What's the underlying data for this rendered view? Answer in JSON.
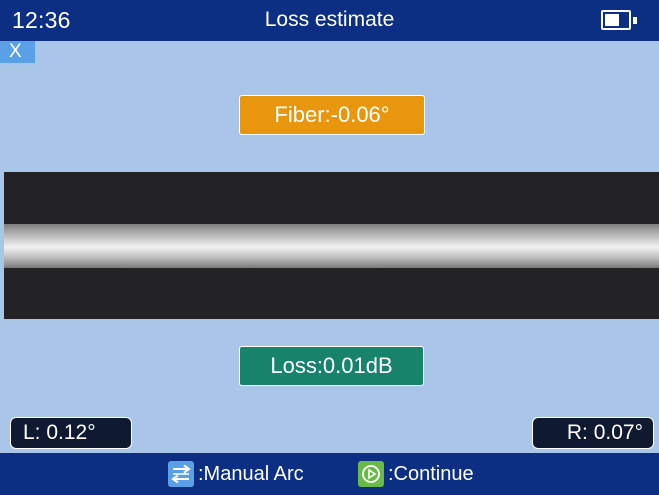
{
  "status_bar": {
    "time": "12:36",
    "title": "Loss estimate",
    "battery_icon": "battery-icon",
    "battery_level": 0.55
  },
  "close_button": {
    "label": "X"
  },
  "fiber_angle": {
    "label": "Fiber:-0.06°"
  },
  "fiber_view": {
    "description_icon": "fiber-image"
  },
  "loss": {
    "label": "Loss:0.01dB"
  },
  "cleave_angles": {
    "left": "L: 0.12°",
    "right": "R: 0.07°"
  },
  "bottom_hints": {
    "manual_arc": {
      "icon": "manual-arc-key-icon",
      "label": ":Manual Arc"
    },
    "continue": {
      "icon": "play-circle-icon",
      "label": ":Continue"
    }
  },
  "colors": {
    "bar_blue": "#0d2f83",
    "background": "#a9c5e7",
    "fiber_badge": "#e8960e",
    "loss_badge": "#16836a",
    "close_button": "#5aa0e6",
    "continue_key": "#6aba4a"
  }
}
